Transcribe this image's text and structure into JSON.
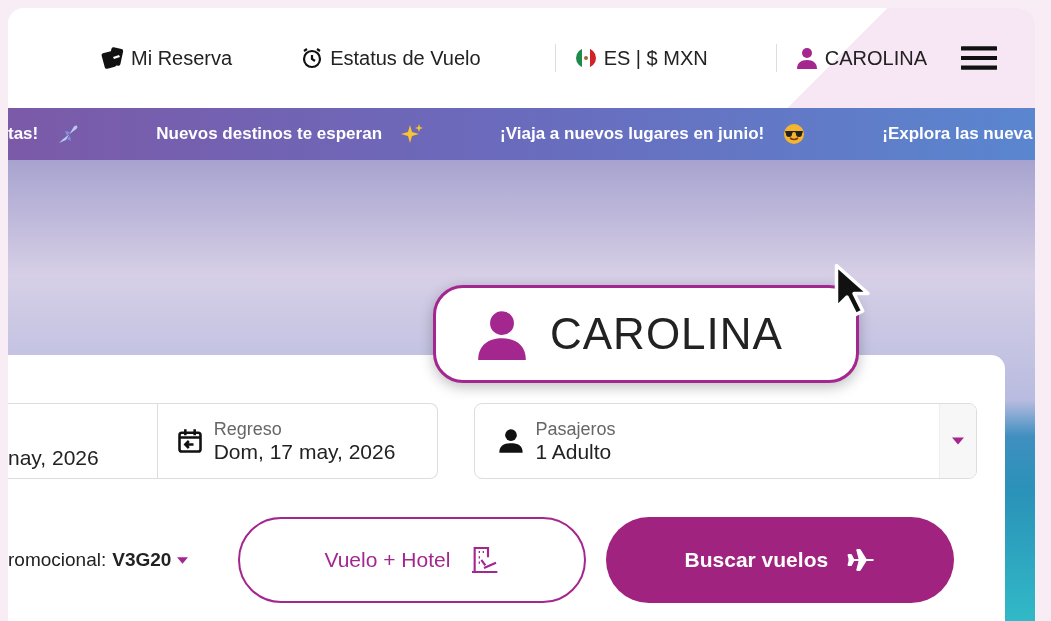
{
  "header": {
    "links": [
      {
        "kind": "booking",
        "label": "Mi Reserva"
      },
      {
        "kind": "status",
        "label": "Estatus de Vuelo"
      },
      {
        "kind": "locale",
        "label": "ES | $ MXN"
      },
      {
        "kind": "user",
        "label": "CAROLINA"
      }
    ]
  },
  "banner": {
    "items": [
      {
        "kind": "plane",
        "text": "tas!"
      },
      {
        "kind": "sparkles",
        "text": "Nuevos destinos te esperan"
      },
      {
        "kind": "smiley",
        "text": "¡Viaja a nuevos lugares en junio!"
      },
      {
        "kind": "none",
        "text": "¡Explora las nueva"
      }
    ]
  },
  "search": {
    "fields": [
      {
        "kind": "date",
        "value": "nay, 2026"
      },
      {
        "kind": "date",
        "label": "Regreso",
        "value": "Dom, 17 may, 2026"
      },
      {
        "kind": "passengers",
        "label": "Pasajeros",
        "value": "1 Adulto"
      }
    ],
    "promo": {
      "label": "romocional:",
      "code": "V3G20"
    },
    "buttons": [
      {
        "kind": "secondary",
        "label": "Vuelo + Hotel"
      },
      {
        "kind": "primary",
        "label": "Buscar vuelos"
      }
    ]
  },
  "callout": {
    "label": "CAROLINA"
  }
}
